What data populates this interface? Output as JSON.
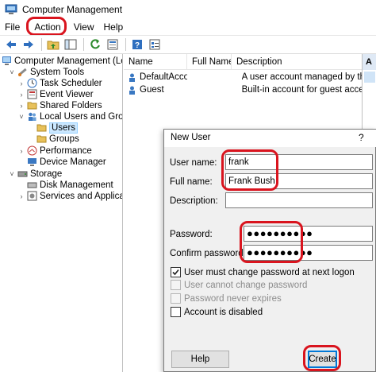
{
  "window": {
    "title": "Computer Management"
  },
  "menu": {
    "file": "File",
    "action": "Action",
    "view": "View",
    "help": "Help"
  },
  "tree": {
    "root": "Computer Management (Local",
    "system_tools": "System Tools",
    "task_scheduler": "Task Scheduler",
    "event_viewer": "Event Viewer",
    "shared_folders": "Shared Folders",
    "local_users_groups": "Local Users and Groups",
    "users": "Users",
    "groups": "Groups",
    "performance": "Performance",
    "device_manager": "Device Manager",
    "storage": "Storage",
    "disk_management": "Disk Management",
    "services_apps": "Services and Applications"
  },
  "list": {
    "columns": {
      "name": "Name",
      "full_name": "Full Name",
      "description": "Description"
    },
    "rows": [
      {
        "name": "DefaultAcco",
        "full_name": "",
        "description": "A user account managed by the system"
      },
      {
        "name": "Guest",
        "full_name": "",
        "description": "Built-in account for guest access to the"
      }
    ]
  },
  "actions": {
    "header": "A"
  },
  "dialog": {
    "title": "New User",
    "help_glyph": "?",
    "username_label": "User name:",
    "username_value": "frank",
    "fullname_label": "Full name:",
    "fullname_value": "Frank Bush",
    "description_label": "Description:",
    "description_value": "",
    "password_label": "Password:",
    "password_value": "●●●●●●●●●●",
    "confirm_label": "Confirm password:",
    "confirm_value": "●●●●●●●●●●",
    "must_change": "User must change password at next logon",
    "must_change_checked": true,
    "cannot_change": "User cannot change password",
    "never_expires": "Password never expires",
    "disabled": "Account is disabled",
    "help_button": "Help",
    "create_button": "Create"
  },
  "colors": {
    "highlight": "#d9141e",
    "selection": "#cce8ff",
    "accent": "#0078d7"
  }
}
